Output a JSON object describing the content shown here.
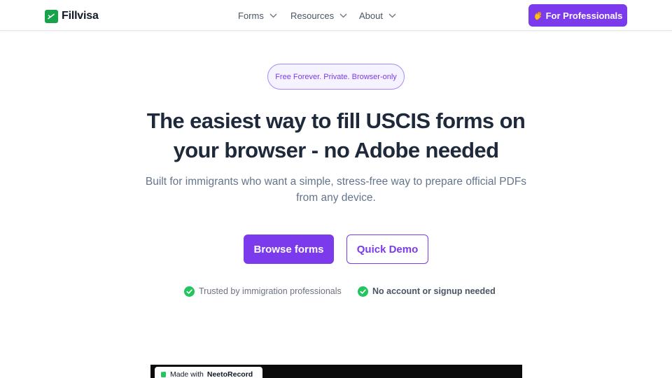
{
  "brand": {
    "name": "Fillvisa",
    "logo_color": "#16a34a"
  },
  "nav": {
    "items": [
      {
        "label": "Forms",
        "icon": "chevron-down-icon"
      },
      {
        "label": "Resources",
        "icon": "chevron-down-icon"
      },
      {
        "label": "About",
        "icon": "chevron-down-icon"
      }
    ],
    "cta_label": "For Professionals",
    "cta_icon": "waving-hand-icon"
  },
  "hero": {
    "pill": "Free Forever. Private. Browser-only",
    "headline_line1": "The easiest way to fill USCIS forms on",
    "headline_line2": "your browser - no Adobe needed",
    "subtext_line1": "Built for immigrants who want a simple, stress-free way to prepare official PDFs",
    "subtext_line2": "from any device.",
    "primary_button": "Browse forms",
    "secondary_button": "Quick Demo",
    "trust_items": [
      {
        "text": "Trusted by immigration professionals",
        "icon": "check-circle-icon"
      },
      {
        "text": "No account or signup needed",
        "icon": "check-circle-icon"
      }
    ]
  },
  "video": {
    "badge_prefix": "Made with",
    "badge_brand": "NeetoRecord"
  },
  "colors": {
    "accent": "#7c3aed",
    "accent_bg_light": "#f5f3ff",
    "accent_border_light": "#a78bfa",
    "success": "#22c55e",
    "heading": "#1e293b",
    "muted": "#64748b"
  }
}
